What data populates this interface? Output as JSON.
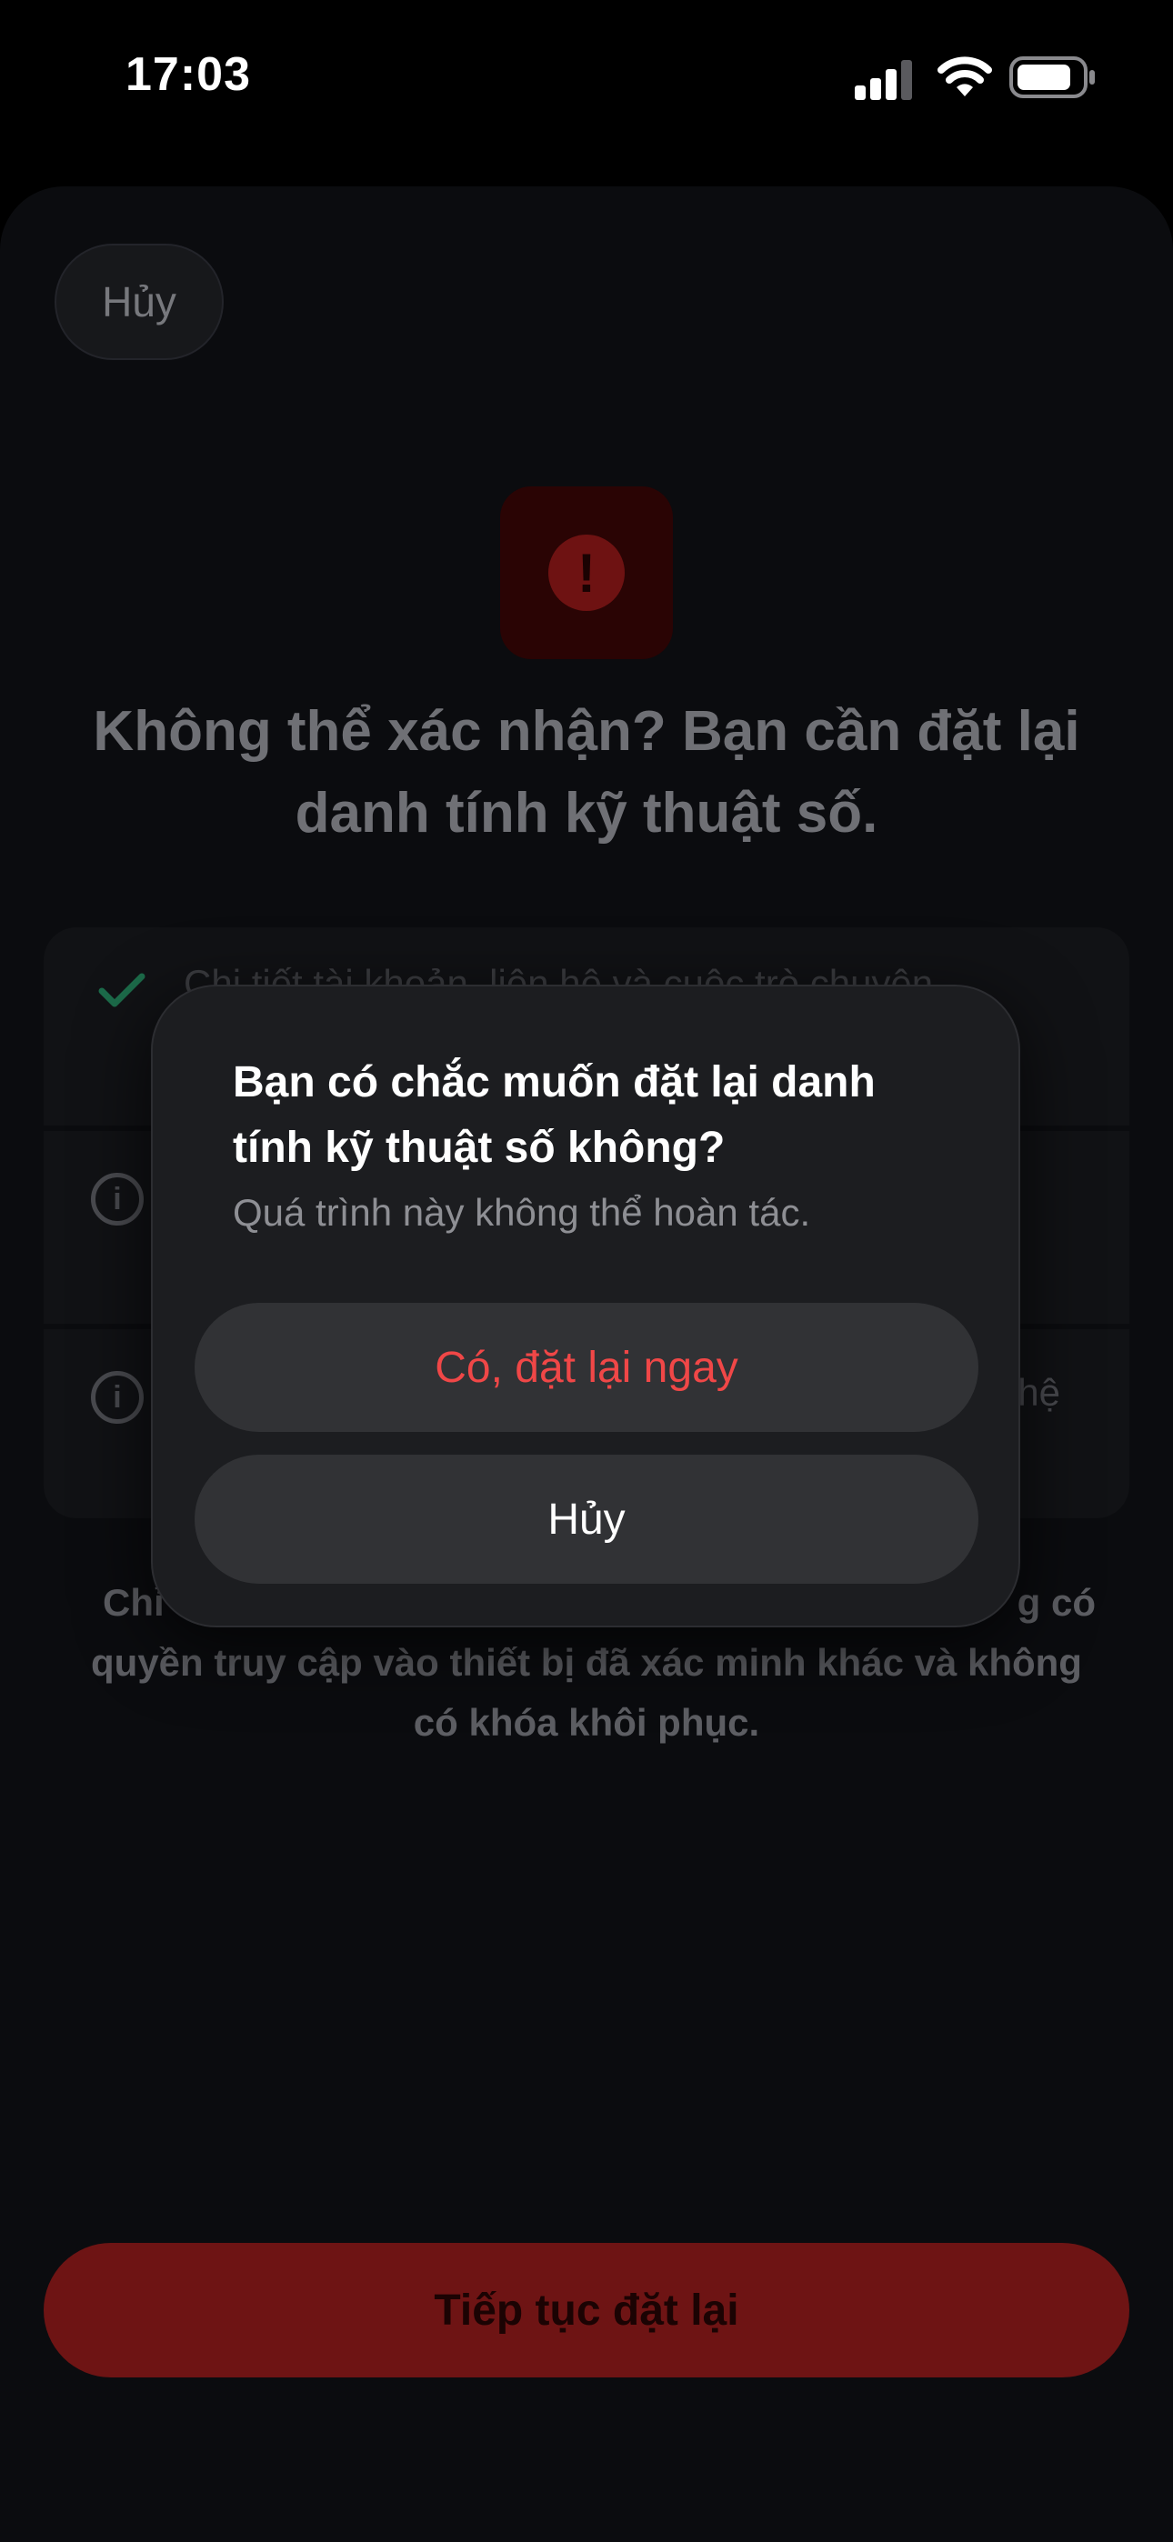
{
  "status_bar": {
    "time": "17:03"
  },
  "cancel_label": "Hủy",
  "headline": "Không thể xác nhận? Bạn cần đặt lại danh tính kỹ thuật số.",
  "info_rows": [
    {
      "text": "Chi tiết tài khoản, liên hệ và cuộc trò chuyện",
      "icon": "check-icon"
    },
    {
      "text": "",
      "icon": "info-icon"
    },
    {
      "text": "",
      "trail": "hệ",
      "icon": "info-icon"
    }
  ],
  "note": "Chỉ ... g có quyền truy cập vào thiết bị đã xác minh khác và không có khóa khôi phục.",
  "note_parts": {
    "start": "Chỉ",
    "end": "g có",
    "line2": "quyền truy cập vào thiết bị đã xác minh khác và không",
    "line3": "có khóa khôi phục."
  },
  "continue_label": "Tiếp tục đặt lại",
  "alert": {
    "title": "Bạn có chắc muốn đặt lại danh tính kỹ thuật số không?",
    "message": "Quá trình này không thể hoàn tác.",
    "confirm_label": "Có, đặt lại ngay",
    "cancel_label": "Hủy"
  },
  "colors": {
    "accent_red": "#f04747",
    "button_red": "#8b1a1a",
    "background": "#0b0c0f"
  }
}
